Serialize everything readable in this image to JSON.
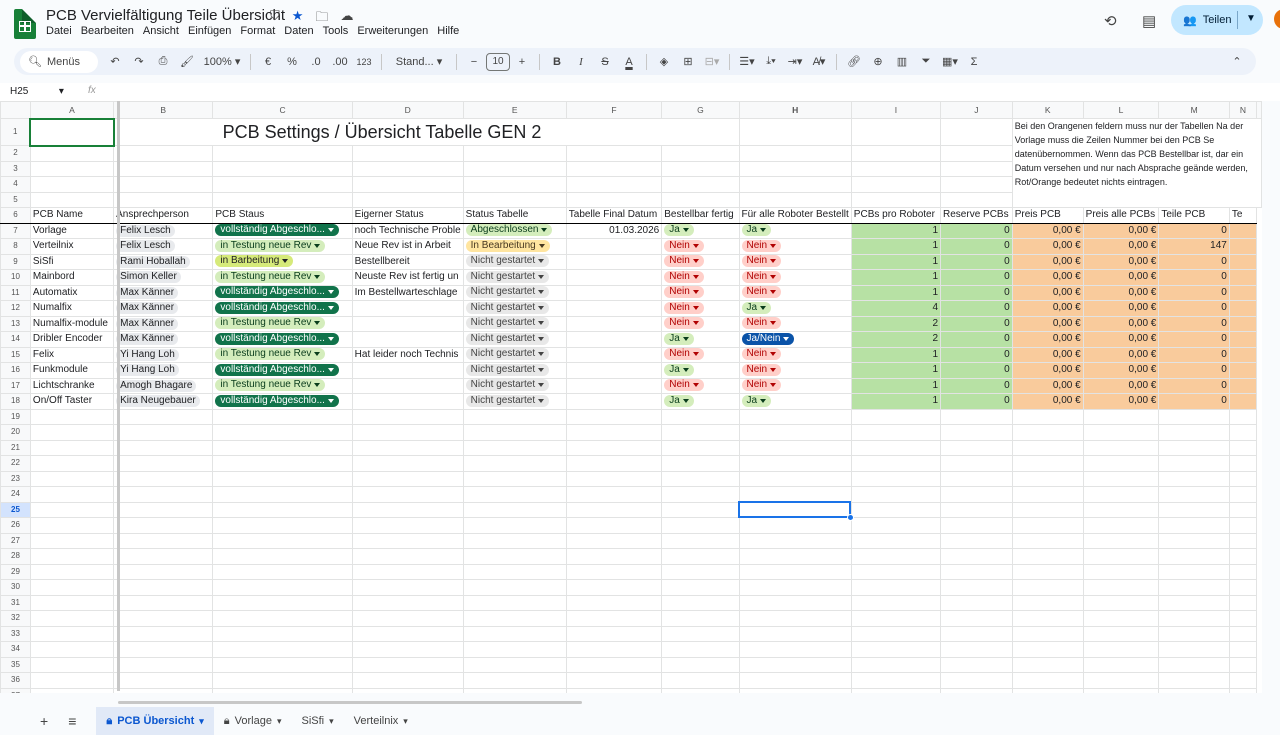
{
  "app": {
    "doc_title": "PCB Vervielfältigung Teile Übersicht",
    "menu": [
      "Datei",
      "Bearbeiten",
      "Ansicht",
      "Einfügen",
      "Format",
      "Daten",
      "Tools",
      "Erweiterungen",
      "Hilfe"
    ],
    "share_label": "Teilen"
  },
  "toolbar": {
    "search_label": "Menüs",
    "zoom": "100%",
    "currency": "€",
    "percent": "%",
    "dec_minus": ".0",
    "dec_plus": ".00",
    "num_format": "123",
    "font": "Stand...",
    "font_size": "10"
  },
  "formula_bar": {
    "cell_ref": "H25",
    "fx": "fx",
    "value": ""
  },
  "columns": [
    "A",
    "B",
    "C",
    "D",
    "E",
    "F",
    "G",
    "H",
    "I",
    "J",
    "K",
    "L",
    "M",
    "N"
  ],
  "grid": {
    "title": "PCB Settings / Übersicht Tabelle GEN 2",
    "note": "Bei den Orangenen feldern muss nur der Tabellen Na der Vorlage muss die Zeilen Nummer bei den PCB Se datenübernommen. Wenn das PCB Bestellbar ist, dar ein Datum versehen und nur nach Absprache geände werden, Rot/Orange bedeutet nichts eintragen.",
    "headers": [
      "PCB Name",
      "Ansprechperson",
      "PCB Staus",
      "Eigerner Status",
      "Status Tabelle",
      "Tabelle Final Datum",
      "Bestellbar fertig",
      "Für alle Roboter Bestellt",
      "PCBs pro Roboter",
      "Reserve PCBs",
      "Preis PCB",
      "Preis alle PCBs",
      "Teile PCB",
      "Te"
    ],
    "rows": [
      {
        "name": "Vorlage",
        "person": "Felix Lesch",
        "staus": "vollständig Abgeschlo...",
        "own": "noch Technische Proble",
        "table": "Abgeschlossen",
        "date": "01.03.2026",
        "orderable": "Ja",
        "all": "Ja",
        "per": "1",
        "reserve": "0",
        "price": "0,00 €",
        "price_all": "0,00 €",
        "parts": "0"
      },
      {
        "name": "Verteilnix",
        "person": "Felix Lesch",
        "staus": "in Testung neue Rev",
        "own": "Neue Rev ist in Arbeit",
        "table": "In Bearbeitung",
        "date": "",
        "orderable": "Nein",
        "all": "Nein",
        "per": "1",
        "reserve": "0",
        "price": "0,00 €",
        "price_all": "0,00 €",
        "parts": "147"
      },
      {
        "name": "SiSfi",
        "person": "Rami Hoballah",
        "staus": "in Barbeitung",
        "own": "Bestellbereit",
        "table": "Nicht gestartet",
        "date": "",
        "orderable": "Nein",
        "all": "Nein",
        "per": "1",
        "reserve": "0",
        "price": "0,00 €",
        "price_all": "0,00 €",
        "parts": "0"
      },
      {
        "name": "Mainbord",
        "person": "Simon Keller",
        "staus": "in Testung neue Rev",
        "own": "Neuste Rev ist fertig un",
        "table": "Nicht gestartet",
        "date": "",
        "orderable": "Nein",
        "all": "Nein",
        "per": "1",
        "reserve": "0",
        "price": "0,00 €",
        "price_all": "0,00 €",
        "parts": "0"
      },
      {
        "name": "Automatix",
        "person": "Max Känner",
        "staus": "vollständig Abgeschlo...",
        "own": "Im Bestellwarteschlage",
        "table": "Nicht gestartet",
        "date": "",
        "orderable": "Nein",
        "all": "Nein",
        "per": "1",
        "reserve": "0",
        "price": "0,00 €",
        "price_all": "0,00 €",
        "parts": "0"
      },
      {
        "name": "Numalfix",
        "person": "Max Känner",
        "staus": "vollständig Abgeschlo...",
        "own": "",
        "table": "Nicht gestartet",
        "date": "",
        "orderable": "Nein",
        "all": "Ja",
        "per": "4",
        "reserve": "0",
        "price": "0,00 €",
        "price_all": "0,00 €",
        "parts": "0"
      },
      {
        "name": "Numalfix-module",
        "person": "Max Känner",
        "staus": "in Testung neue Rev",
        "own": "",
        "table": "Nicht gestartet",
        "date": "",
        "orderable": "Nein",
        "all": "Nein",
        "per": "2",
        "reserve": "0",
        "price": "0,00 €",
        "price_all": "0,00 €",
        "parts": "0"
      },
      {
        "name": "Dribler Encoder",
        "person": "Max Känner",
        "staus": "vollständig Abgeschlo...",
        "own": "",
        "table": "Nicht gestartet",
        "date": "",
        "orderable": "Ja",
        "all": "Ja/Nein",
        "per": "2",
        "reserve": "0",
        "price": "0,00 €",
        "price_all": "0,00 €",
        "parts": "0"
      },
      {
        "name": "Felix",
        "person": "Yi Hang Loh",
        "staus": "in Testung neue Rev",
        "own": "Hat leider noch Technis",
        "table": "Nicht gestartet",
        "date": "",
        "orderable": "Nein",
        "all": "Nein",
        "per": "1",
        "reserve": "0",
        "price": "0,00 €",
        "price_all": "0,00 €",
        "parts": "0"
      },
      {
        "name": "Funkmodule",
        "person": "Yi Hang Loh",
        "staus": "vollständig Abgeschlo...",
        "own": "",
        "table": "Nicht gestartet",
        "date": "",
        "orderable": "Ja",
        "all": "Nein",
        "per": "1",
        "reserve": "0",
        "price": "0,00 €",
        "price_all": "0,00 €",
        "parts": "0"
      },
      {
        "name": "Lichtschranke",
        "person": "Amogh Bhagare",
        "staus": "in Testung neue Rev",
        "own": "",
        "table": "Nicht gestartet",
        "date": "",
        "orderable": "Nein",
        "all": "Nein",
        "per": "1",
        "reserve": "0",
        "price": "0,00 €",
        "price_all": "0,00 €",
        "parts": "0"
      },
      {
        "name": "On/Off Taster",
        "person": "Kira Neugebauer",
        "staus": "vollständig Abgeschlo...",
        "own": "",
        "table": "Nicht gestartet",
        "date": "",
        "orderable": "Ja",
        "all": "Ja",
        "per": "1",
        "reserve": "0",
        "price": "0,00 €",
        "price_all": "0,00 €",
        "parts": "0"
      }
    ]
  },
  "tabs": [
    {
      "label": "PCB Übersicht",
      "locked": true,
      "active": true
    },
    {
      "label": "Vorlage",
      "locked": true,
      "active": false
    },
    {
      "label": "SiSfi",
      "locked": false,
      "active": false
    },
    {
      "label": "Verteilnix",
      "locked": false,
      "active": false
    }
  ],
  "colors": {
    "accent": "#0b57d0",
    "selection": "#1a73e8",
    "green_fill": "#b7e1a4",
    "orange_fill": "#f9cb9c",
    "share_bg": "#c2e7ff"
  }
}
